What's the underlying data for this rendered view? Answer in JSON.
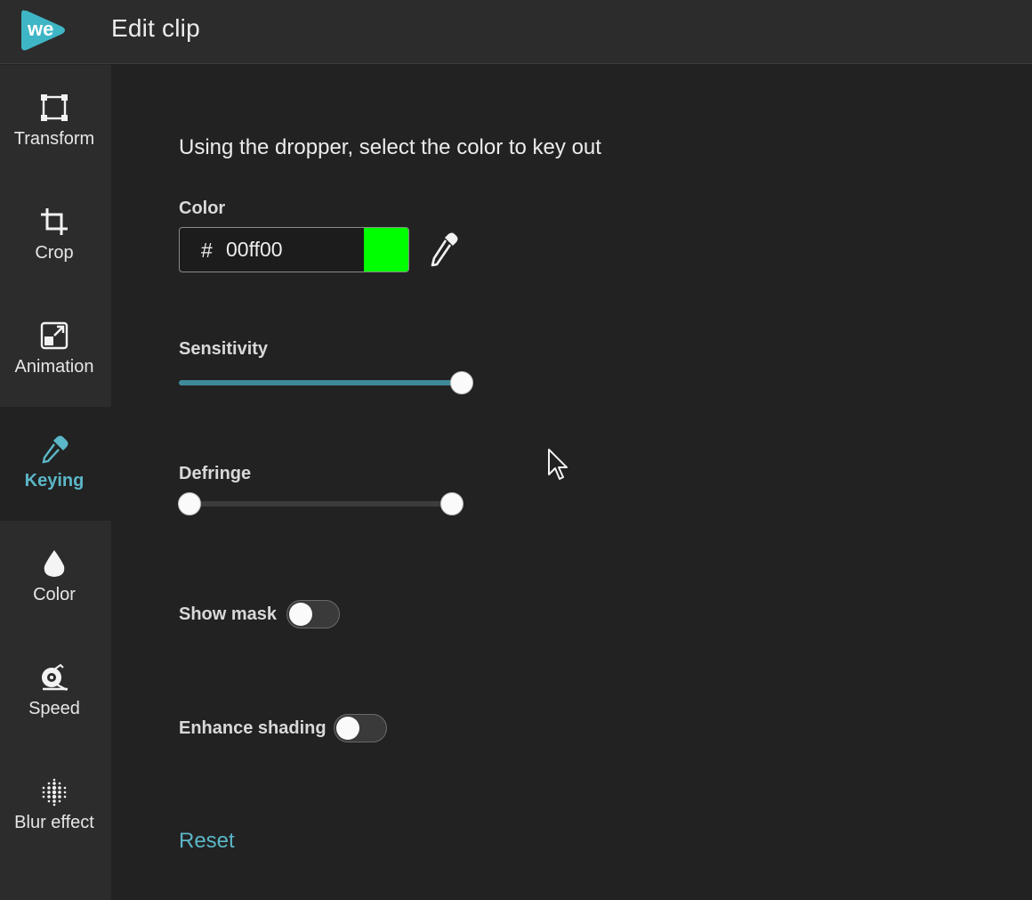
{
  "header": {
    "title": "Edit clip",
    "logo_text": "we"
  },
  "sidebar": {
    "items": [
      {
        "label": "Transform",
        "icon": "transform-icon"
      },
      {
        "label": "Crop",
        "icon": "crop-icon"
      },
      {
        "label": "Animation",
        "icon": "animation-icon"
      },
      {
        "label": "Keying",
        "icon": "dropper-icon",
        "active": true
      },
      {
        "label": "Color",
        "icon": "drop-icon"
      },
      {
        "label": "Speed",
        "icon": "speed-icon"
      },
      {
        "label": "Blur effect",
        "icon": "blur-icon"
      }
    ]
  },
  "keying": {
    "instruction": "Using the dropper, select the color to key out",
    "color_label": "Color",
    "color_hash": "#",
    "color_value": "00ff00",
    "swatch_color": "#00ff00",
    "sensitivity_label": "Sensitivity",
    "sensitivity_value": 1.0,
    "defringe_label": "Defringe",
    "defringe_range": [
      0.0,
      1.0
    ],
    "show_mask_label": "Show mask",
    "show_mask_on": false,
    "enhance_shading_label": "Enhance shading",
    "enhance_shading_on": false,
    "reset_label": "Reset"
  },
  "colors": {
    "accent": "#5bb7c7",
    "slider_fill": "#3f8a98",
    "logo": "#3fb6c6"
  }
}
